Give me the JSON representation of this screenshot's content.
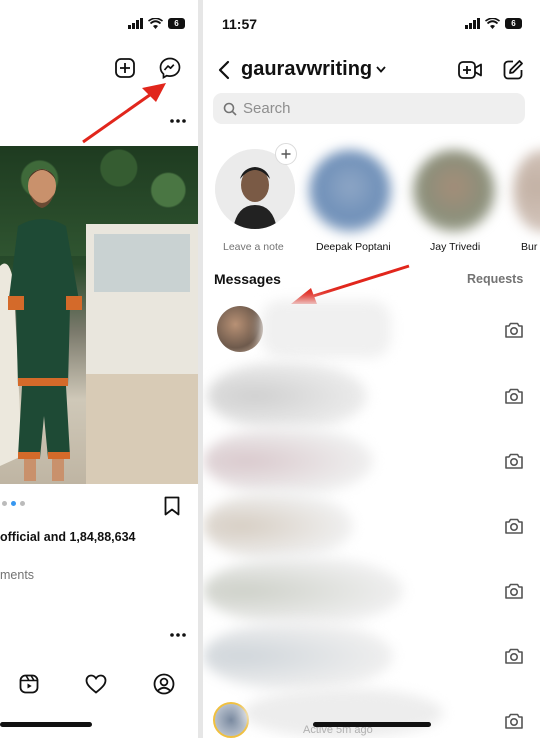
{
  "left_panel": {
    "likes_text_user": "official and ",
    "likes_text_count": "1,84,88,634",
    "comments_text": "ments"
  },
  "right_panel": {
    "status": {
      "time": "11:57",
      "battery": "6"
    },
    "header": {
      "username": "gauravwriting"
    },
    "search": {
      "placeholder": "Search"
    },
    "stories": [
      {
        "label": "Leave a note"
      },
      {
        "label": "Deepak Poptani"
      },
      {
        "label": "Jay Trivedi"
      },
      {
        "label": "Bur"
      }
    ],
    "messages_heading": "Messages",
    "requests_label": "Requests",
    "last_row_time": "Active 5m ago"
  },
  "colors": {
    "arrow": "#e1261c",
    "accent": "#111111",
    "muted": "#737373"
  }
}
